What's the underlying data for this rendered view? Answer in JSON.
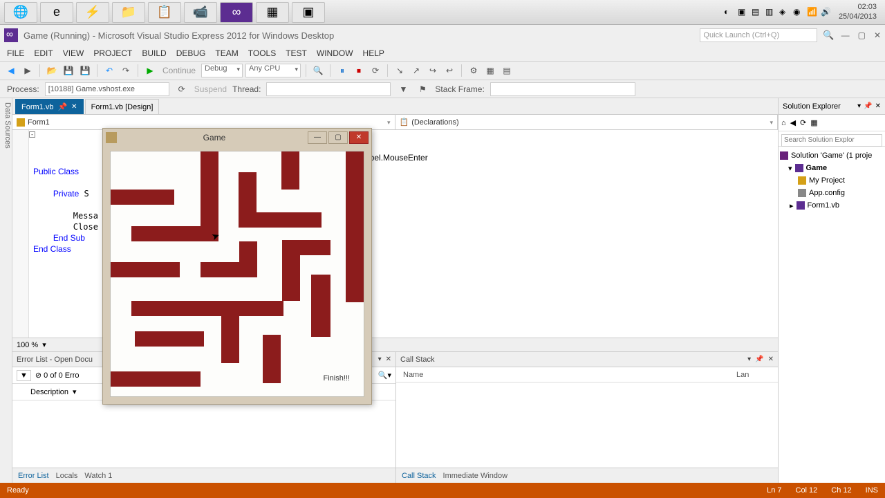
{
  "taskbar": {
    "tray": {
      "time": "02:03",
      "date": "25/04/2013"
    }
  },
  "vs": {
    "title": "Game (Running) - Microsoft Visual Studio Express 2012 for Windows Desktop",
    "quick_launch_placeholder": "Quick Launch (Ctrl+Q)",
    "menu": [
      "FILE",
      "EDIT",
      "VIEW",
      "PROJECT",
      "BUILD",
      "DEBUG",
      "TEAM",
      "TOOLS",
      "TEST",
      "WINDOW",
      "HELP"
    ],
    "toolbar": {
      "continue_label": "Continue",
      "config": "Debug",
      "platform": "Any CPU"
    },
    "debugbar": {
      "process_label": "Process:",
      "process_value": "[10188] Game.vshost.exe",
      "suspend_label": "Suspend",
      "thread_label": "Thread:",
      "stackframe_label": "Stack Frame:"
    },
    "left_tab": "Data Sources",
    "doc_tabs": [
      {
        "label": "Form1.vb",
        "active": true,
        "pinned": true
      },
      {
        "label": "Form1.vb [Design]",
        "active": false
      }
    ],
    "class_left": "Form1",
    "class_right": "(Declarations)",
    "code_visible": "Public Class\n\n    Private S\n\n        Messa\n        Close\n    End Sub\nEnd Class",
    "code_handler_fragment": "nbel.MouseEnter",
    "zoom": "100 %",
    "error_list": {
      "title": "Error List - Open Docu",
      "count": "0 of 0 Erro",
      "col_desc": "Description"
    },
    "callstack": {
      "title": "Call Stack",
      "col_name": "Name",
      "col_lang": "Lan"
    },
    "bottom_tabs_left": [
      "Error List",
      "Locals",
      "Watch 1"
    ],
    "bottom_tabs_right": [
      "Call Stack",
      "Immediate Window"
    ],
    "solution": {
      "title": "Solution Explorer",
      "search_placeholder": "Search Solution Explor",
      "root": "Solution 'Game' (1 proje",
      "project": "Game",
      "items": [
        "My Project",
        "App.config",
        "Form1.vb"
      ]
    },
    "status": {
      "ready": "Ready",
      "ln": "Ln 7",
      "col": "Col 12",
      "ch": "Ch 12",
      "ins": "INS"
    }
  },
  "game": {
    "title": "Game",
    "finish": "Finish!!!"
  }
}
